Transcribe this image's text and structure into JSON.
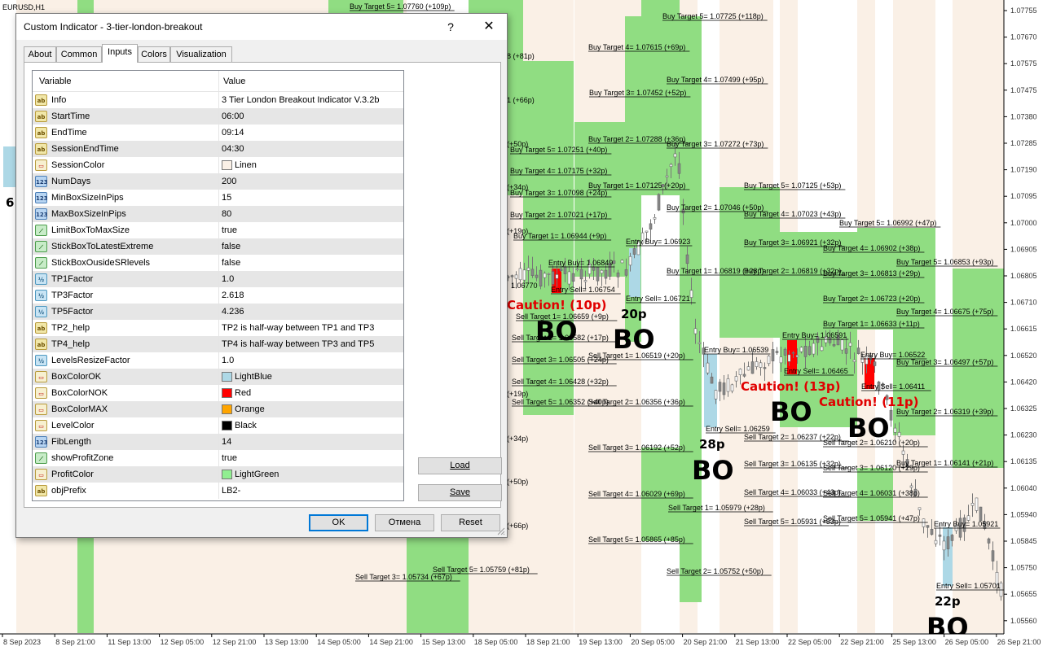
{
  "chart": {
    "symbol": "EURUSD,H1",
    "price_axis": [
      "1.07755",
      "1.07670",
      "1.07575",
      "1.07475",
      "1.07380",
      "1.07285",
      "1.07190",
      "1.07095",
      "1.07000",
      "1.06905",
      "1.06805",
      "1.06710",
      "1.06615",
      "1.06520",
      "1.06420",
      "1.06325",
      "1.06230",
      "1.06135",
      "1.06040",
      "1.05940",
      "1.05845",
      "1.05750",
      "1.05655",
      "1.05560"
    ],
    "time_axis": [
      "8 Sep 2023",
      "8 Sep 21:00",
      "11 Sep 13:00",
      "12 Sep 05:00",
      "12 Sep 21:00",
      "13 Sep 13:00",
      "14 Sep 05:00",
      "14 Sep 21:00",
      "15 Sep 13:00",
      "18 Sep 05:00",
      "18 Sep 21:00",
      "19 Sep 13:00",
      "20 Sep 05:00",
      "20 Sep 21:00",
      "21 Sep 13:00",
      "22 Sep 05:00",
      "22 Sep 21:00",
      "25 Sep 13:00",
      "26 Sep 05:00",
      "26 Sep 21:00"
    ],
    "labels": [
      "Buy Target 5= 1.07760 (+109p)",
      "Buy Target 5= 1.07725 (+118p)",
      "Buy Target 4= 1.07615 (+69p)",
      "Buy Target 4= 1.07499 (+95p)",
      "Buy Target 3= 1.07452 (+52p)",
      "Buy Target 2= 1.07288 (+36p)",
      "Buy Target 3= 1.07272 (+73p)",
      "Buy Target 5= 1.07251 (+40p)",
      "Buy Target 4= 1.07175 (+32p)",
      "Buy Target 1= 1.07125 (+20p)",
      "Buy Target 5= 1.07125 (+53p)",
      "Buy Target 3= 1.07098 (+24p)",
      "Buy Target 2= 1.07046 (+50p)",
      "Buy Target 2= 1.07021 (+17p)",
      "Buy Target 4= 1.07023 (+43p)",
      "Buy Target 5= 1.06992 (+47p)",
      "Buy Target 1= 1.06944 (+9p)",
      "Entry Buy= 1.06923",
      "Buy Target 3= 1.06921 (+32p)",
      "Buy Target 4= 1.06902 (+38p)",
      "Buy Target 5= 1.06853 (+93p)",
      "Entry Buy= 1.06849",
      "Buy Target 1= 1.06819 (+28p)",
      "Buy Target 2= 1.06819 (+32p)",
      "Buy Target 3= 1.06813 (+29p)",
      "Entry Sell= 1.06754",
      "Entry Sell= 1.06721",
      "Buy Target 2= 1.06723 (+20p)",
      "Buy Target 4= 1.06675 (+75p)",
      "Sell Target 1= 1.06659 (+9p)",
      "Buy Target 1= 1.06633 (+11p)",
      "Entry Buy= 1.06591",
      "Sell Target 2= 1.06582 (+17p)",
      "Entry Buy= 1.06539",
      "Entry Buy= 1.06522",
      "Sell Target 1= 1.06519 (+20p)",
      "Sell Target 3= 1.06505 (+24p)",
      "Buy Target 3= 1.06497 (+57p)",
      "Entry Sell= 1.06465",
      "Sell Target 4= 1.06428 (+32p)",
      "Entry Sell= 1.06411",
      "Sell Target 2= 1.06356 (+36p)",
      "Sell Target 5= 1.06352 (+40p)",
      "Buy Target 2= 1.06319 (+39p)",
      "Entry Sell= 1.06259",
      "Sell Target 2= 1.06237 (+22p)",
      "Sell Target 2= 1.06210 (+20p)",
      "Sell Target 3= 1.06192 (+52p)",
      "Buy Target 1= 1.06141 (+21p)",
      "Sell Target 3= 1.06135 (+32p)",
      "Sell Target 3= 1.06120 (+29p)",
      "Sell Target 4= 1.06029 (+69p)",
      "Sell Target 4= 1.06033 (+43p)",
      "Sell Target 4= 1.06031 (+38p)",
      "Sell Target 1= 1.05979 (+28p)",
      "Sell Target 5= 1.05931 (+53p)",
      "Sell Target 5= 1.05941 (+47p)",
      "Entry Buy= 1.05921",
      "Sell Target 5= 1.05865 (+85p)",
      "Sell Target 5= 1.05759 (+81p)",
      "Sell Target 2= 1.05752 (+50p)",
      "Sell Target 3= 1.05734 (+67p)",
      "Entry Sell= 1.05701"
    ],
    "left_clipped": [
      "8 (+81p)",
      "1 (+66p)",
      "(+50p)",
      "(+34p)",
      "(+19p)",
      "1.06770",
      "(+19p)",
      "(+34p)",
      "(+50p)",
      "(+66p)"
    ],
    "bo_label": "BO",
    "pip_labels": [
      "20p",
      "28p",
      "22p",
      "6"
    ],
    "caution_labels": [
      "Caution! (10p)",
      "Caution! (13p)",
      "Caution! (11p)"
    ]
  },
  "dialog": {
    "title": "Custom Indicator - 3-tier-london-breakout",
    "help": "?",
    "close": "✕",
    "tabs": [
      "About",
      "Common",
      "Inputs",
      "Colors",
      "Visualization"
    ],
    "active_tab": "Inputs",
    "columns": {
      "variable": "Variable",
      "value": "Value"
    },
    "rows": [
      {
        "type": "ab",
        "name": "Info",
        "value": "3 Tier London Breakout Indicator V.3.2b"
      },
      {
        "type": "ab",
        "name": "StartTime",
        "value": "06:00"
      },
      {
        "type": "ab",
        "name": "EndTime",
        "value": "09:14"
      },
      {
        "type": "ab",
        "name": "SessionEndTime",
        "value": "04:30"
      },
      {
        "type": "color",
        "name": "SessionColor",
        "value": "Linen",
        "swatch": "#faf0e6"
      },
      {
        "type": "123",
        "name": "NumDays",
        "value": "200"
      },
      {
        "type": "123",
        "name": "MinBoxSizeInPips",
        "value": "15"
      },
      {
        "type": "123",
        "name": "MaxBoxSizeInPips",
        "value": "80"
      },
      {
        "type": "bool",
        "name": "LimitBoxToMaxSize",
        "value": "true"
      },
      {
        "type": "bool",
        "name": "StickBoxToLatestExtreme",
        "value": "false"
      },
      {
        "type": "bool",
        "name": "StickBoxOusideSRlevels",
        "value": "false"
      },
      {
        "type": "dbl",
        "name": "TP1Factor",
        "value": "1.0"
      },
      {
        "type": "dbl",
        "name": "TP3Factor",
        "value": "2.618"
      },
      {
        "type": "dbl",
        "name": "TP5Factor",
        "value": "4.236"
      },
      {
        "type": "ab",
        "name": "TP2_help",
        "value": "TP2 is half-way between TP1 and TP3"
      },
      {
        "type": "ab",
        "name": "TP4_help",
        "value": "TP4 is half-way between TP3 and TP5"
      },
      {
        "type": "dbl",
        "name": "LevelsResizeFactor",
        "value": "1.0"
      },
      {
        "type": "color",
        "name": "BoxColorOK",
        "value": "LightBlue",
        "swatch": "#add8e6"
      },
      {
        "type": "color",
        "name": "BoxColorNOK",
        "value": "Red",
        "swatch": "#ff0000"
      },
      {
        "type": "color",
        "name": "BoxColorMAX",
        "value": "Orange",
        "swatch": "#ffa500"
      },
      {
        "type": "color",
        "name": "LevelColor",
        "value": "Black",
        "swatch": "#000000"
      },
      {
        "type": "123",
        "name": "FibLength",
        "value": "14"
      },
      {
        "type": "bool",
        "name": "showProfitZone",
        "value": "true"
      },
      {
        "type": "color",
        "name": "ProfitColor",
        "value": "LightGreen",
        "swatch": "#90ee90"
      },
      {
        "type": "ab",
        "name": "objPrefix",
        "value": "LB2-"
      }
    ],
    "buttons": {
      "load": "Load",
      "save": "Save",
      "ok": "OK",
      "cancel": "Отмена",
      "reset": "Reset"
    }
  },
  "colors": {
    "session": "#faf0e6",
    "profit": "#90dd82",
    "box_ok": "#add8e6",
    "box_nok": "#ff0000",
    "accent": "#0078d7"
  }
}
